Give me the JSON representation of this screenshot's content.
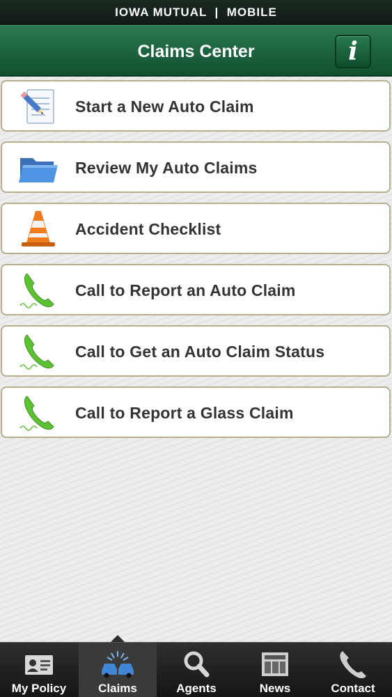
{
  "status_bar": {
    "brand": "IOWA MUTUAL  |  MOBILE"
  },
  "header": {
    "title": "Claims Center",
    "info_label": "i"
  },
  "menu": [
    {
      "label": "Start a New Auto Claim",
      "icon": "form-pencil-icon"
    },
    {
      "label": "Review My Auto Claims",
      "icon": "folder-icon"
    },
    {
      "label": "Accident Checklist",
      "icon": "traffic-cone-icon"
    },
    {
      "label": "Call to Report an Auto Claim",
      "icon": "phone-icon"
    },
    {
      "label": "Call to Get an Auto Claim Status",
      "icon": "phone-icon"
    },
    {
      "label": "Call to Report a Glass Claim",
      "icon": "phone-icon"
    }
  ],
  "tabs": [
    {
      "label": "My Policy",
      "icon": "id-card-icon"
    },
    {
      "label": "Claims",
      "icon": "car-crash-icon",
      "active": true
    },
    {
      "label": "Agents",
      "icon": "magnifier-icon"
    },
    {
      "label": "News",
      "icon": "newspaper-icon"
    },
    {
      "label": "Contact",
      "icon": "phone-icon"
    }
  ],
  "colors": {
    "header_green": "#1d6440",
    "phone_green": "#5cc232",
    "row_border": "#b7ae8a",
    "tabbar": "#1e1e1e"
  }
}
